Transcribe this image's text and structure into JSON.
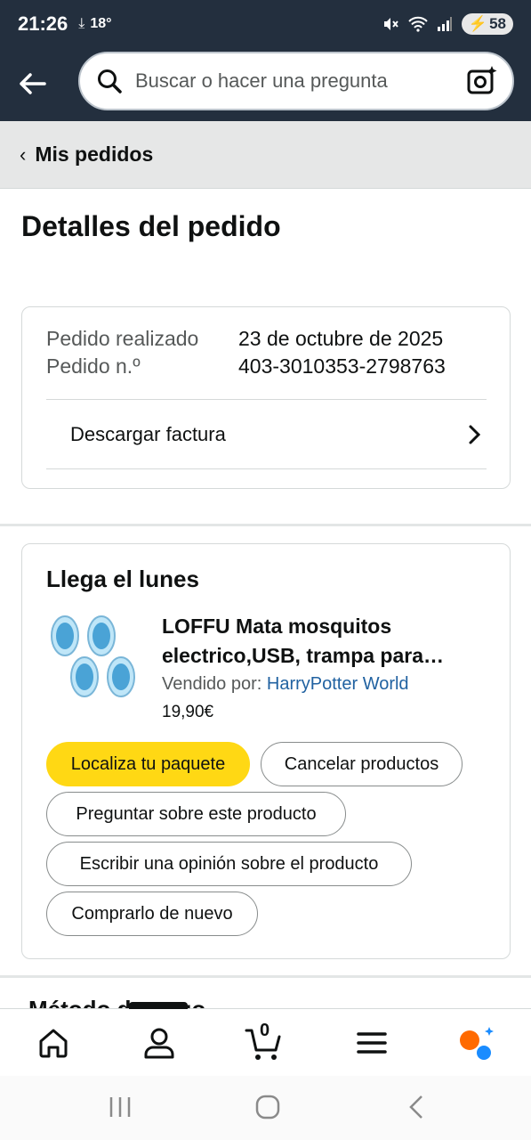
{
  "status_bar": {
    "time": "21:26",
    "temperature": "18°",
    "battery": "58"
  },
  "search": {
    "placeholder": "Buscar o hacer una pregunta"
  },
  "breadcrumb": {
    "label": "Mis pedidos"
  },
  "page_title": "Detalles del pedido",
  "order_info": {
    "placed_label": "Pedido realizado",
    "placed_value": "23 de octubre de 2025",
    "number_label": "Pedido n.º",
    "number_value": "403-3010353-2798763",
    "invoice_label": "Descargar factura"
  },
  "shipment": {
    "arrival": "Llega el lunes",
    "product_title": "LOFFU Mata mosquitos electrico,USB, trampa para…",
    "sold_by_label": "Vendido por:",
    "seller": "HarryPotter World",
    "price": "19,90€",
    "buttons": {
      "track": "Localiza tu paquete",
      "cancel": "Cancelar productos",
      "ask": "Preguntar sobre este producto",
      "review": "Escribir una opinión sobre el producto",
      "buy_again": "Comprarlo de nuevo"
    }
  },
  "next_section": "Método de pago",
  "bottom_nav": {
    "cart_count": "0",
    "active": "account"
  },
  "colors": {
    "header_bg": "#232f3e",
    "primary_button": "#ffd814",
    "link": "#2162a1",
    "rufus_orange": "#ff6a00",
    "rufus_blue": "#1a8cff"
  }
}
